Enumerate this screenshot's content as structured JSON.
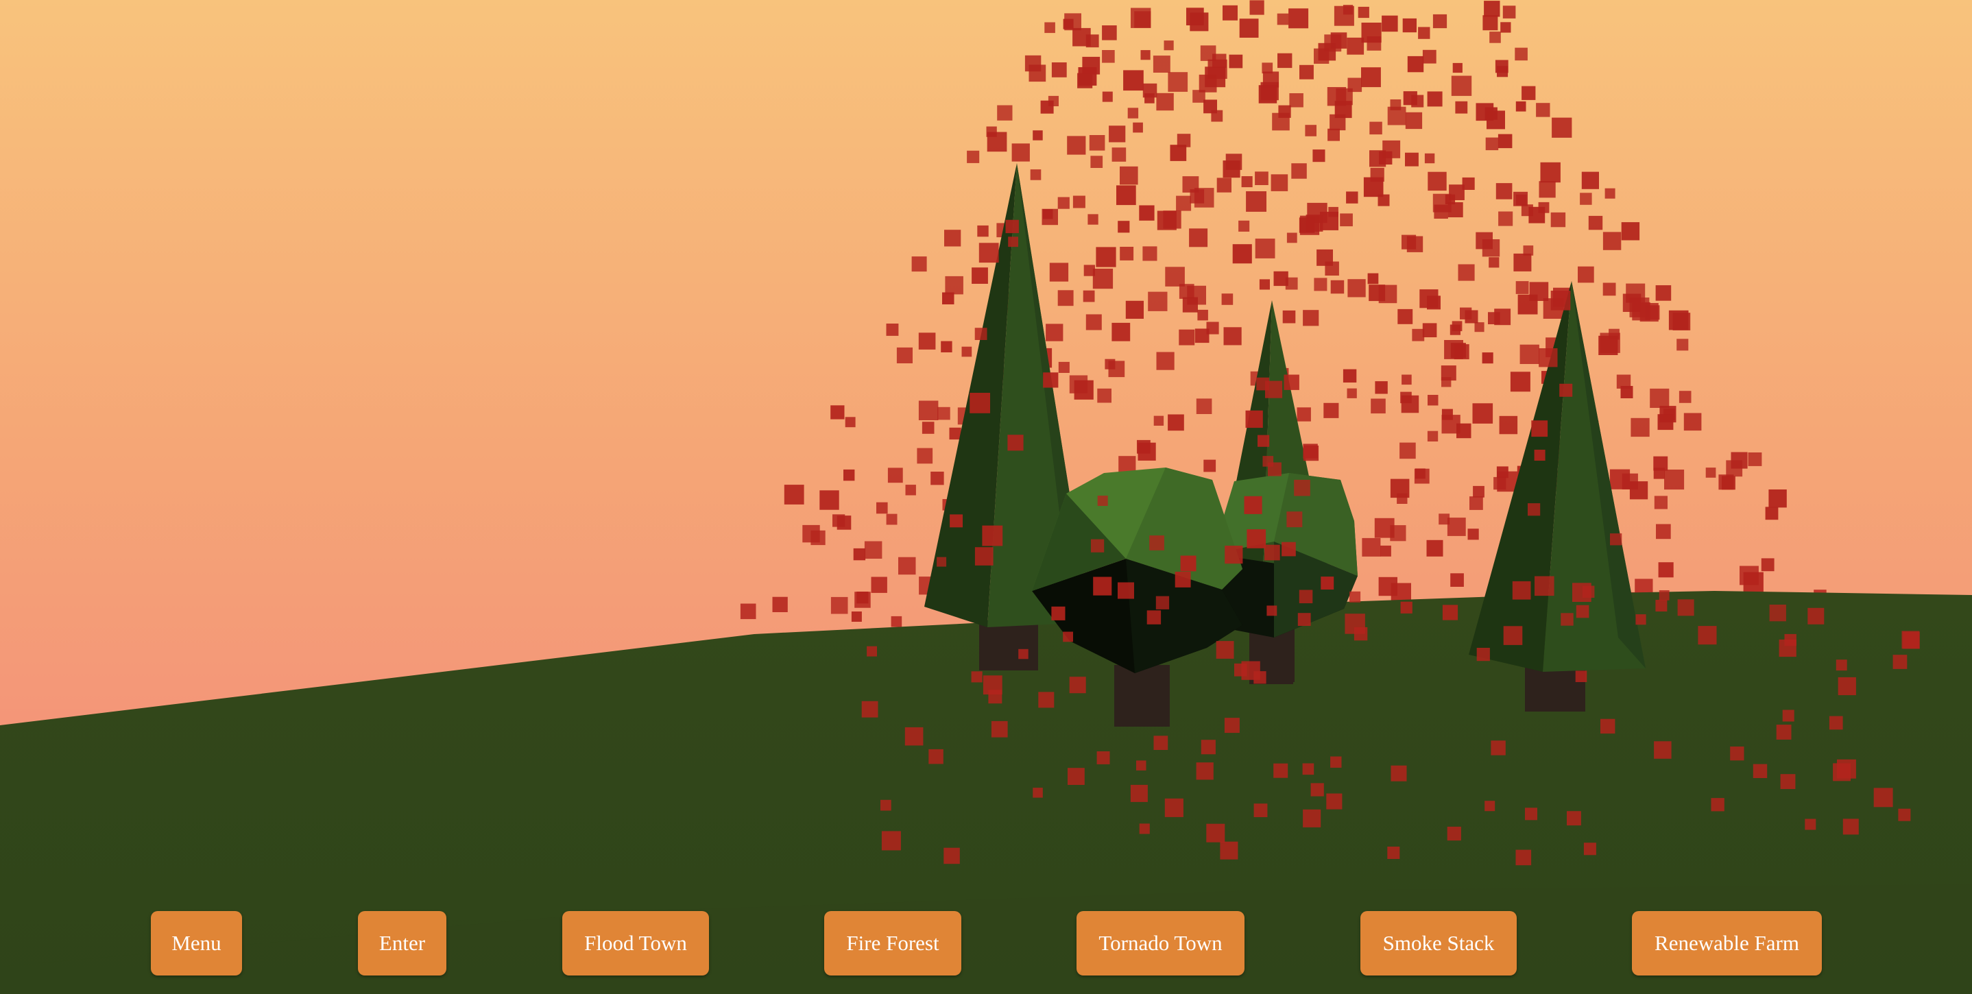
{
  "scene": {
    "name": "Fire Forest",
    "sky_top_color": "#f8c37c",
    "sky_bottom_color": "#f2867a",
    "ground_color": "#32481a",
    "ember_color": "#b3231c",
    "trees": [
      "pine-tree",
      "bush-tree",
      "pine-tree",
      "bush-tree",
      "pine-tree"
    ]
  },
  "nav": {
    "buttons": [
      {
        "label": "Menu"
      },
      {
        "label": "Enter"
      },
      {
        "label": "Flood Town"
      },
      {
        "label": "Fire Forest"
      },
      {
        "label": "Tornado Town"
      },
      {
        "label": "Smoke Stack"
      },
      {
        "label": "Renewable Farm"
      }
    ],
    "button_color": "#e08536"
  }
}
